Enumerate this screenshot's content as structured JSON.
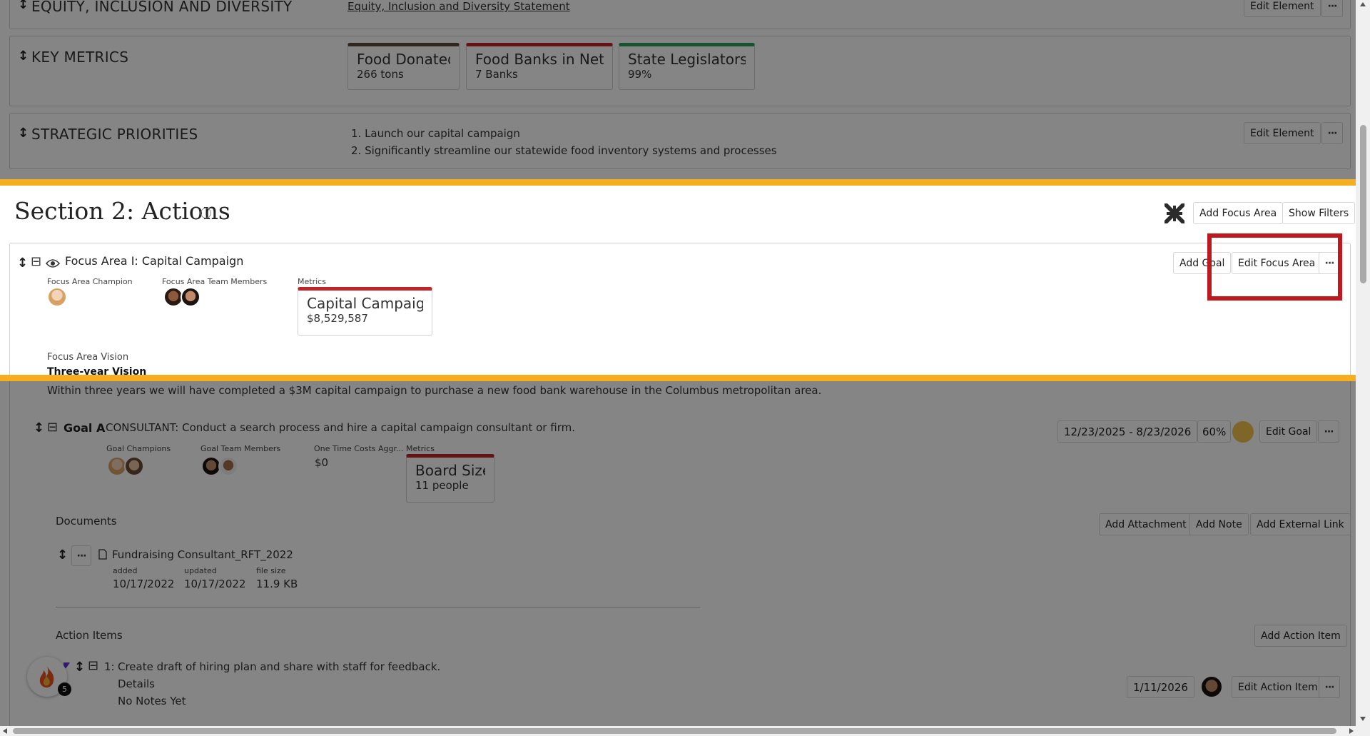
{
  "section1": {
    "equity": {
      "label": "EQUITY, INCLUSION AND DIVERSITY",
      "link": "Equity, Inclusion and Diversity Statement",
      "edit": "Edit Element"
    },
    "key_metrics": {
      "label": "KEY METRICS",
      "tiles": [
        {
          "title": "Food Donated",
          "value": "266 tons",
          "color": "#5b4a3c"
        },
        {
          "title": "Food Banks in Net...",
          "value": "7 Banks",
          "color": "#c0252a"
        },
        {
          "title": "State Legislators...",
          "value": "99%",
          "color": "#2f9e5a"
        }
      ]
    },
    "strategic": {
      "label": "STRATEGIC PRIORITIES",
      "items": [
        "1. Launch our capital campaign",
        "2. Significantly streamline our statewide food inventory systems and processes"
      ],
      "edit": "Edit Element"
    }
  },
  "section2": {
    "title": "Section 2: Actions",
    "add_focus_area": "Add Focus Area",
    "show_filters": "Show Filters",
    "focus_area": {
      "title": "Focus Area I: Capital Campaign",
      "add_goal": "Add Goal",
      "edit_focus_area": "Edit Focus Area",
      "champion_label": "Focus Area Champion",
      "team_label": "Focus Area Team Members",
      "metrics_label": "Metrics",
      "metric": {
        "title": "Capital Campaign",
        "value": "$8,529,587",
        "color": "#c0252a"
      },
      "vision_label": "Focus Area Vision",
      "vision_title": "Three-year Vision",
      "vision_text": "Within three years we will have completed a $3M capital campaign to purchase a new food bank warehouse in the Columbus metropolitan area."
    },
    "goal": {
      "label": "Goal A",
      "text": "CONSULTANT: Conduct a search process and hire a capital campaign consultant or firm.",
      "dates": "12/23/2025 - 8/23/2026",
      "progress": "60%",
      "status_color": "#f2c14e",
      "edit": "Edit Goal",
      "champions_label": "Goal Champions",
      "team_label": "Goal Team Members",
      "costs_label": "One Time Costs Aggr...",
      "costs_value": "$0",
      "metrics_label": "Metrics",
      "metric": {
        "title": "Board Size",
        "value": "11 people",
        "color": "#c0252a"
      }
    },
    "documents": {
      "label": "Documents",
      "add_attachment": "Add Attachment",
      "add_note": "Add Note",
      "add_link": "Add External Link",
      "file": {
        "name": "Fundraising Consultant_RFT_2022",
        "added_label": "added",
        "added": "10/17/2022",
        "updated_label": "updated",
        "updated": "10/17/2022",
        "size_label": "file size",
        "size": "11.9 KB"
      }
    },
    "action_items": {
      "label": "Action Items",
      "add": "Add Action Item",
      "item": {
        "number": "1:",
        "text": "Create draft of hiring plan and share with staff for feedback.",
        "details": "Details",
        "notes": "No Notes Yet",
        "date": "1/11/2026",
        "edit": "Edit Action Item"
      }
    }
  },
  "badge": {
    "count": "5"
  },
  "icons": {
    "more": "···",
    "drag": "↕",
    "collapse": "⊟",
    "info": "i"
  },
  "highlight_color": "#c0181f",
  "band_color": "#f6ad1e"
}
